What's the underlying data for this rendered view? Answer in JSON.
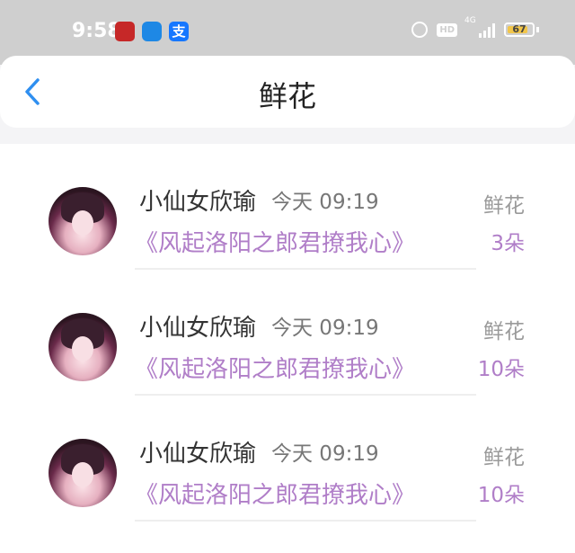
{
  "status_bar": {
    "time": "9:58",
    "network": "4G",
    "battery": "67"
  },
  "nav": {
    "title": "鲜花"
  },
  "rows": [
    {
      "username": "小仙女欣瑜",
      "time": "今天 09:19",
      "book": "《风起洛阳之郎君撩我心》",
      "gift_type": "鲜花",
      "gift_count": "3朵"
    },
    {
      "username": "小仙女欣瑜",
      "time": "今天 09:19",
      "book": "《风起洛阳之郎君撩我心》",
      "gift_type": "鲜花",
      "gift_count": "10朵"
    },
    {
      "username": "小仙女欣瑜",
      "time": "今天 09:19",
      "book": "《风起洛阳之郎君撩我心》",
      "gift_type": "鲜花",
      "gift_count": "10朵"
    }
  ],
  "colors": {
    "accent": "#b07ec8",
    "back_arrow": "#2f8ff0",
    "status_bar": "#cfcfcf"
  }
}
